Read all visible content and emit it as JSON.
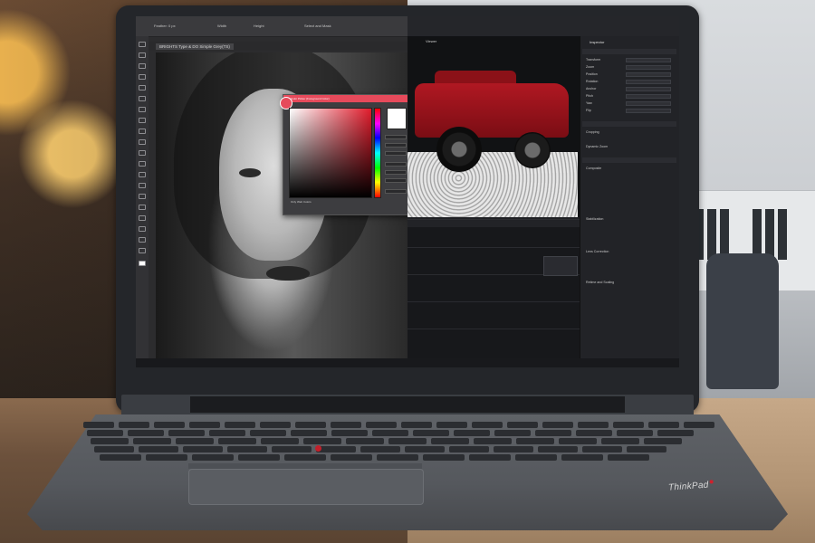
{
  "editor_left": {
    "document_tab": "BRIGHTS Type & DO Simple Grey(TS)",
    "options_bar": [
      "Feather: 0 px",
      "Width",
      "Height",
      "Select and Mask"
    ],
    "color_picker": {
      "title": "Color Picker (Foreground Color)",
      "only_web_colors": "Only Web Colors",
      "new_color": "#ffffff",
      "field_color": "#e11c2c"
    }
  },
  "editor_right": {
    "viewer_title": "Viewer",
    "inspector_title": "Inspector",
    "inspector_rows": [
      "Transform",
      "Zoom",
      "Position",
      "Rotation",
      "Anchor",
      "Pitch",
      "Yaw",
      "Flip"
    ],
    "inspector_sections": [
      "Cropping",
      "Dynamic Zoom",
      "Composite",
      "Stabilization",
      "Lens Correction",
      "Retime and Scaling"
    ]
  },
  "device": {
    "brand": "ThinkPad",
    "accent_color": "#c21f2a"
  }
}
